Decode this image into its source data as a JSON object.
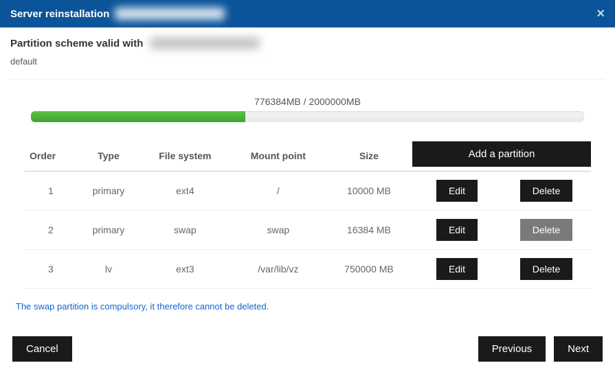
{
  "header": {
    "title_prefix": "Server reinstallation",
    "close_glyph": "×"
  },
  "scheme": {
    "label_prefix": "Partition scheme valid with",
    "default_label": "default"
  },
  "usage": {
    "used_mb": 776384,
    "total_mb": 2000000,
    "text": "776384MB / 2000000MB",
    "percent": 38.8
  },
  "table": {
    "headers": {
      "order": "Order",
      "type": "Type",
      "filesystem": "File system",
      "mountpoint": "Mount point",
      "size": "Size"
    },
    "add_label": "Add a partition",
    "edit_label": "Edit",
    "delete_label": "Delete",
    "rows": [
      {
        "order": "1",
        "type": "primary",
        "fs": "ext4",
        "mount": "/",
        "size": "10000 MB",
        "delete_disabled": false
      },
      {
        "order": "2",
        "type": "primary",
        "fs": "swap",
        "mount": "swap",
        "size": "16384 MB",
        "delete_disabled": true
      },
      {
        "order": "3",
        "type": "lv",
        "fs": "ext3",
        "mount": "/var/lib/vz",
        "size": "750000 MB",
        "delete_disabled": false
      }
    ]
  },
  "note": "The swap partition is compulsory, it therefore cannot be deleted.",
  "footer": {
    "cancel": "Cancel",
    "previous": "Previous",
    "next": "Next"
  }
}
